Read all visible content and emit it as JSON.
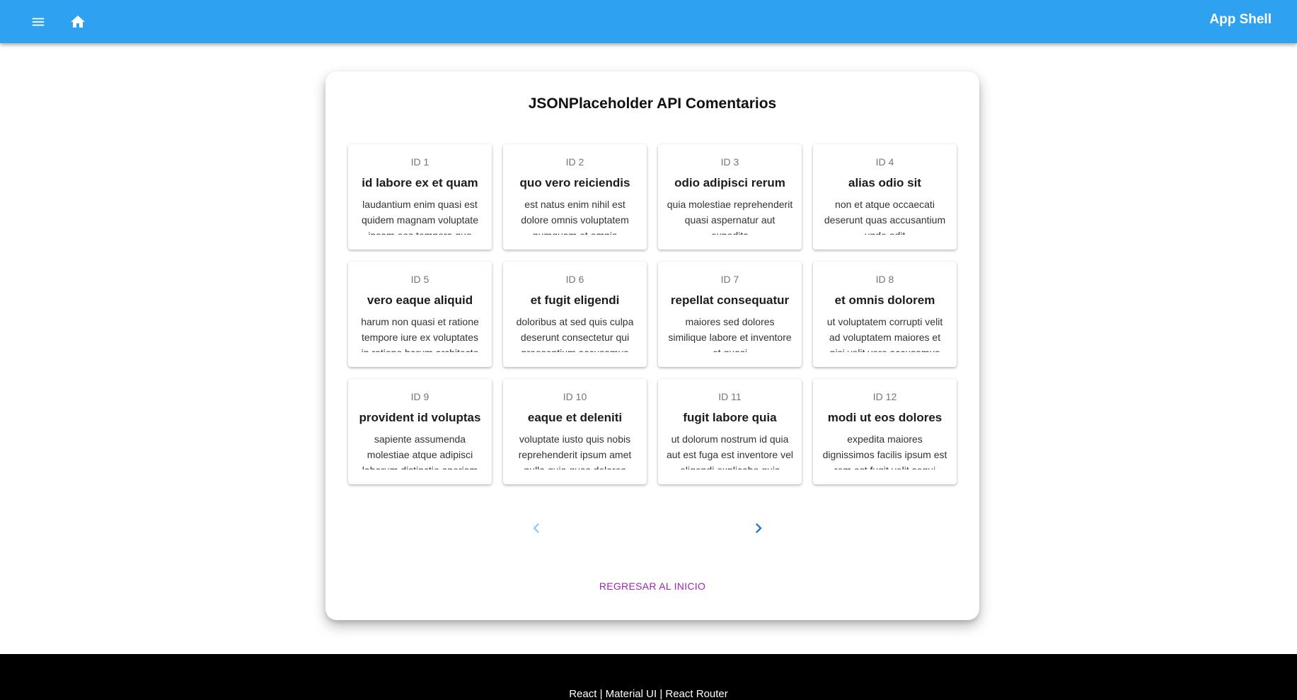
{
  "header": {
    "title": "App Shell",
    "menu_icon": "menu-icon",
    "home_icon": "home-icon",
    "bg_color": "#2ea1f0"
  },
  "main": {
    "title": "JSONPlaceholder API Comentarios",
    "cards": [
      {
        "id": "ID 1",
        "name": "id labore ex et quam",
        "body": "laudantium enim quasi est quidem magnam voluptate ipsam eos tempora quo"
      },
      {
        "id": "ID 2",
        "name": "quo vero reiciendis",
        "body": "est natus enim nihil est dolore omnis voluptatem numquam et omnis"
      },
      {
        "id": "ID 3",
        "name": "odio adipisci rerum",
        "body": "quia molestiae reprehenderit quasi aspernatur aut expedita"
      },
      {
        "id": "ID 4",
        "name": "alias odio sit",
        "body": "non et atque occaecati deserunt quas accusantium unde odit"
      },
      {
        "id": "ID 5",
        "name": "vero eaque aliquid",
        "body": "harum non quasi et ratione tempore iure ex voluptates in ratione harum architecto"
      },
      {
        "id": "ID 6",
        "name": "et fugit eligendi",
        "body": "doloribus at sed quis culpa deserunt consectetur qui praesentium accusamus"
      },
      {
        "id": "ID 7",
        "name": "repellat consequatur",
        "body": "maiores sed dolores similique labore et inventore et quasi"
      },
      {
        "id": "ID 8",
        "name": "et omnis dolorem",
        "body": "ut voluptatem corrupti velit ad voluptatem maiores et nisi velit vero accusamus"
      },
      {
        "id": "ID 9",
        "name": "provident id voluptas",
        "body": "sapiente assumenda molestiae atque adipisci laborum distinctio aperiam"
      },
      {
        "id": "ID 10",
        "name": "eaque et deleniti",
        "body": "voluptate iusto quis nobis reprehenderit ipsum amet nulla quia quas dolores"
      },
      {
        "id": "ID 11",
        "name": "fugit labore quia",
        "body": "ut dolorum nostrum id quia aut est fuga est inventore vel eligendi explicabo quis"
      },
      {
        "id": "ID 12",
        "name": "modi ut eos dolores",
        "body": "expedita maiores dignissimos facilis ipsum est rem est fugit velit sequi"
      }
    ],
    "pagination": {
      "prev_icon": "chevron-left-icon",
      "next_icon": "chevron-right-icon",
      "prev_color": "#90caf9",
      "next_color": "#1976d2"
    },
    "back_label": "REGRESAR AL INICIO",
    "back_color": "#9c27b0"
  },
  "footer": {
    "text": "React | Material UI | React Router"
  }
}
